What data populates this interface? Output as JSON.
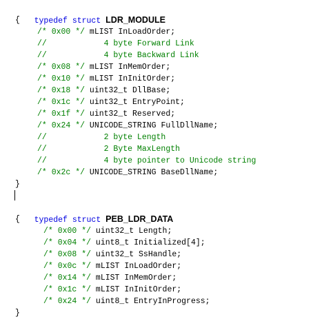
{
  "code": {
    "struct1": {
      "typedef_kw": "typedef",
      "struct_kw": "struct",
      "name": "LDR_MODULE",
      "open_brace": "{",
      "close_brace": "}",
      "fields": [
        {
          "offset": "/* 0x00 */",
          "decl": "mLIST InLoadOrder;"
        },
        {
          "comment": "//            4 byte Forward Link"
        },
        {
          "comment": "//            4 byte Backward Link"
        },
        {
          "offset": "/* 0x08 */",
          "decl": "mLIST InMemOrder;"
        },
        {
          "offset": "/* 0x10 */",
          "decl": "mLIST InInitOrder;"
        },
        {
          "offset": "/* 0x18 */",
          "decl": "uint32_t DllBase;"
        },
        {
          "offset": "/* 0x1c */",
          "decl": "uint32_t EntryPoint;"
        },
        {
          "offset": "/* 0x1f */",
          "decl": "uint32_t Reserved;"
        },
        {
          "offset": "/* 0x24 */",
          "decl": "UNICODE_STRING FullDllName;"
        },
        {
          "comment": "//            2 byte Length"
        },
        {
          "comment": "//            2 Byte MaxLength"
        },
        {
          "comment": "//            4 byte pointer to Unicode string"
        },
        {
          "offset": "/* 0x2c */",
          "decl": "UNICODE_STRING BaseDllName;"
        }
      ]
    },
    "struct2": {
      "typedef_kw": "typedef",
      "struct_kw": "struct",
      "name": "PEB_LDR_DATA",
      "open_brace": "{",
      "close_brace": "}",
      "fields": [
        {
          "offset": "/* 0x00 */",
          "decl": "uint32_t Length;"
        },
        {
          "offset": "/* 0x04 */",
          "decl": "uint8_t Initialized[4];"
        },
        {
          "offset": "/* 0x08 */",
          "decl": "uint32_t SsHandle;"
        },
        {
          "offset": "/* 0x0c */",
          "decl": "mLIST InLoadOrder;"
        },
        {
          "offset": "/* 0x14 */",
          "decl": "mLIST InMemOrder;"
        },
        {
          "offset": "/* 0x1c */",
          "decl": "mLIST InInitOrder;"
        },
        {
          "offset": "/* 0x24 */",
          "decl": "uint8_t EntryInProgress;"
        }
      ]
    },
    "colors": {
      "keyword": "#0000e0",
      "comment": "#008000",
      "text": "#000000"
    }
  }
}
